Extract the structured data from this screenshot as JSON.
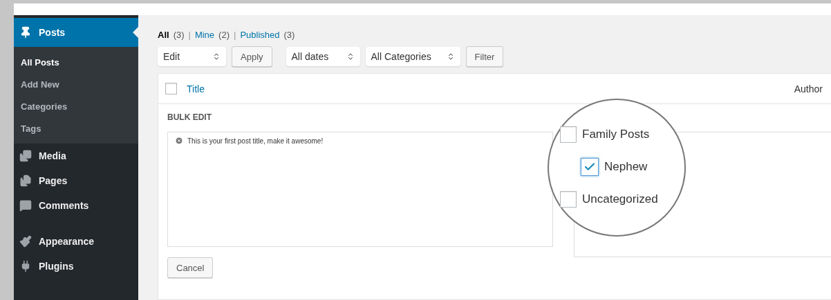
{
  "sidebar": {
    "items": [
      {
        "label": "Posts",
        "selected": true,
        "children": [
          {
            "label": "All Posts",
            "selected": true
          },
          {
            "label": "Add New",
            "selected": false
          },
          {
            "label": "Categories",
            "selected": false
          },
          {
            "label": "Tags",
            "selected": false
          }
        ]
      },
      {
        "label": "Media",
        "selected": false
      },
      {
        "label": "Pages",
        "selected": false
      },
      {
        "label": "Comments",
        "selected": false
      },
      {
        "label": "Appearance",
        "selected": false
      },
      {
        "label": "Plugins",
        "selected": false
      }
    ]
  },
  "views": [
    {
      "label": "All",
      "count": "(3)",
      "selected": true
    },
    {
      "separator": "|",
      "label": "Mine",
      "count": "(2)",
      "selected": false
    },
    {
      "separator": "|",
      "label": "Published",
      "count": "(3)",
      "selected": false
    }
  ],
  "toolbar": {
    "bulk_action": "Edit",
    "apply": "Apply",
    "dates": "All dates",
    "categories": "All Categories",
    "filter": "Filter"
  },
  "table": {
    "columns": [
      "Title",
      "Author"
    ],
    "select_all": {
      "checked": false
    }
  },
  "bulk_edit": {
    "heading": "BULK EDIT",
    "titles": [
      "This is your first post title, make it awesome!"
    ],
    "categories": [
      {
        "label": "Family Posts",
        "checked": false,
        "children": [
          {
            "label": "Nephew",
            "checked": true
          }
        ]
      },
      {
        "label": "Uncategorized",
        "checked": false
      }
    ],
    "cancel": "Cancel"
  }
}
